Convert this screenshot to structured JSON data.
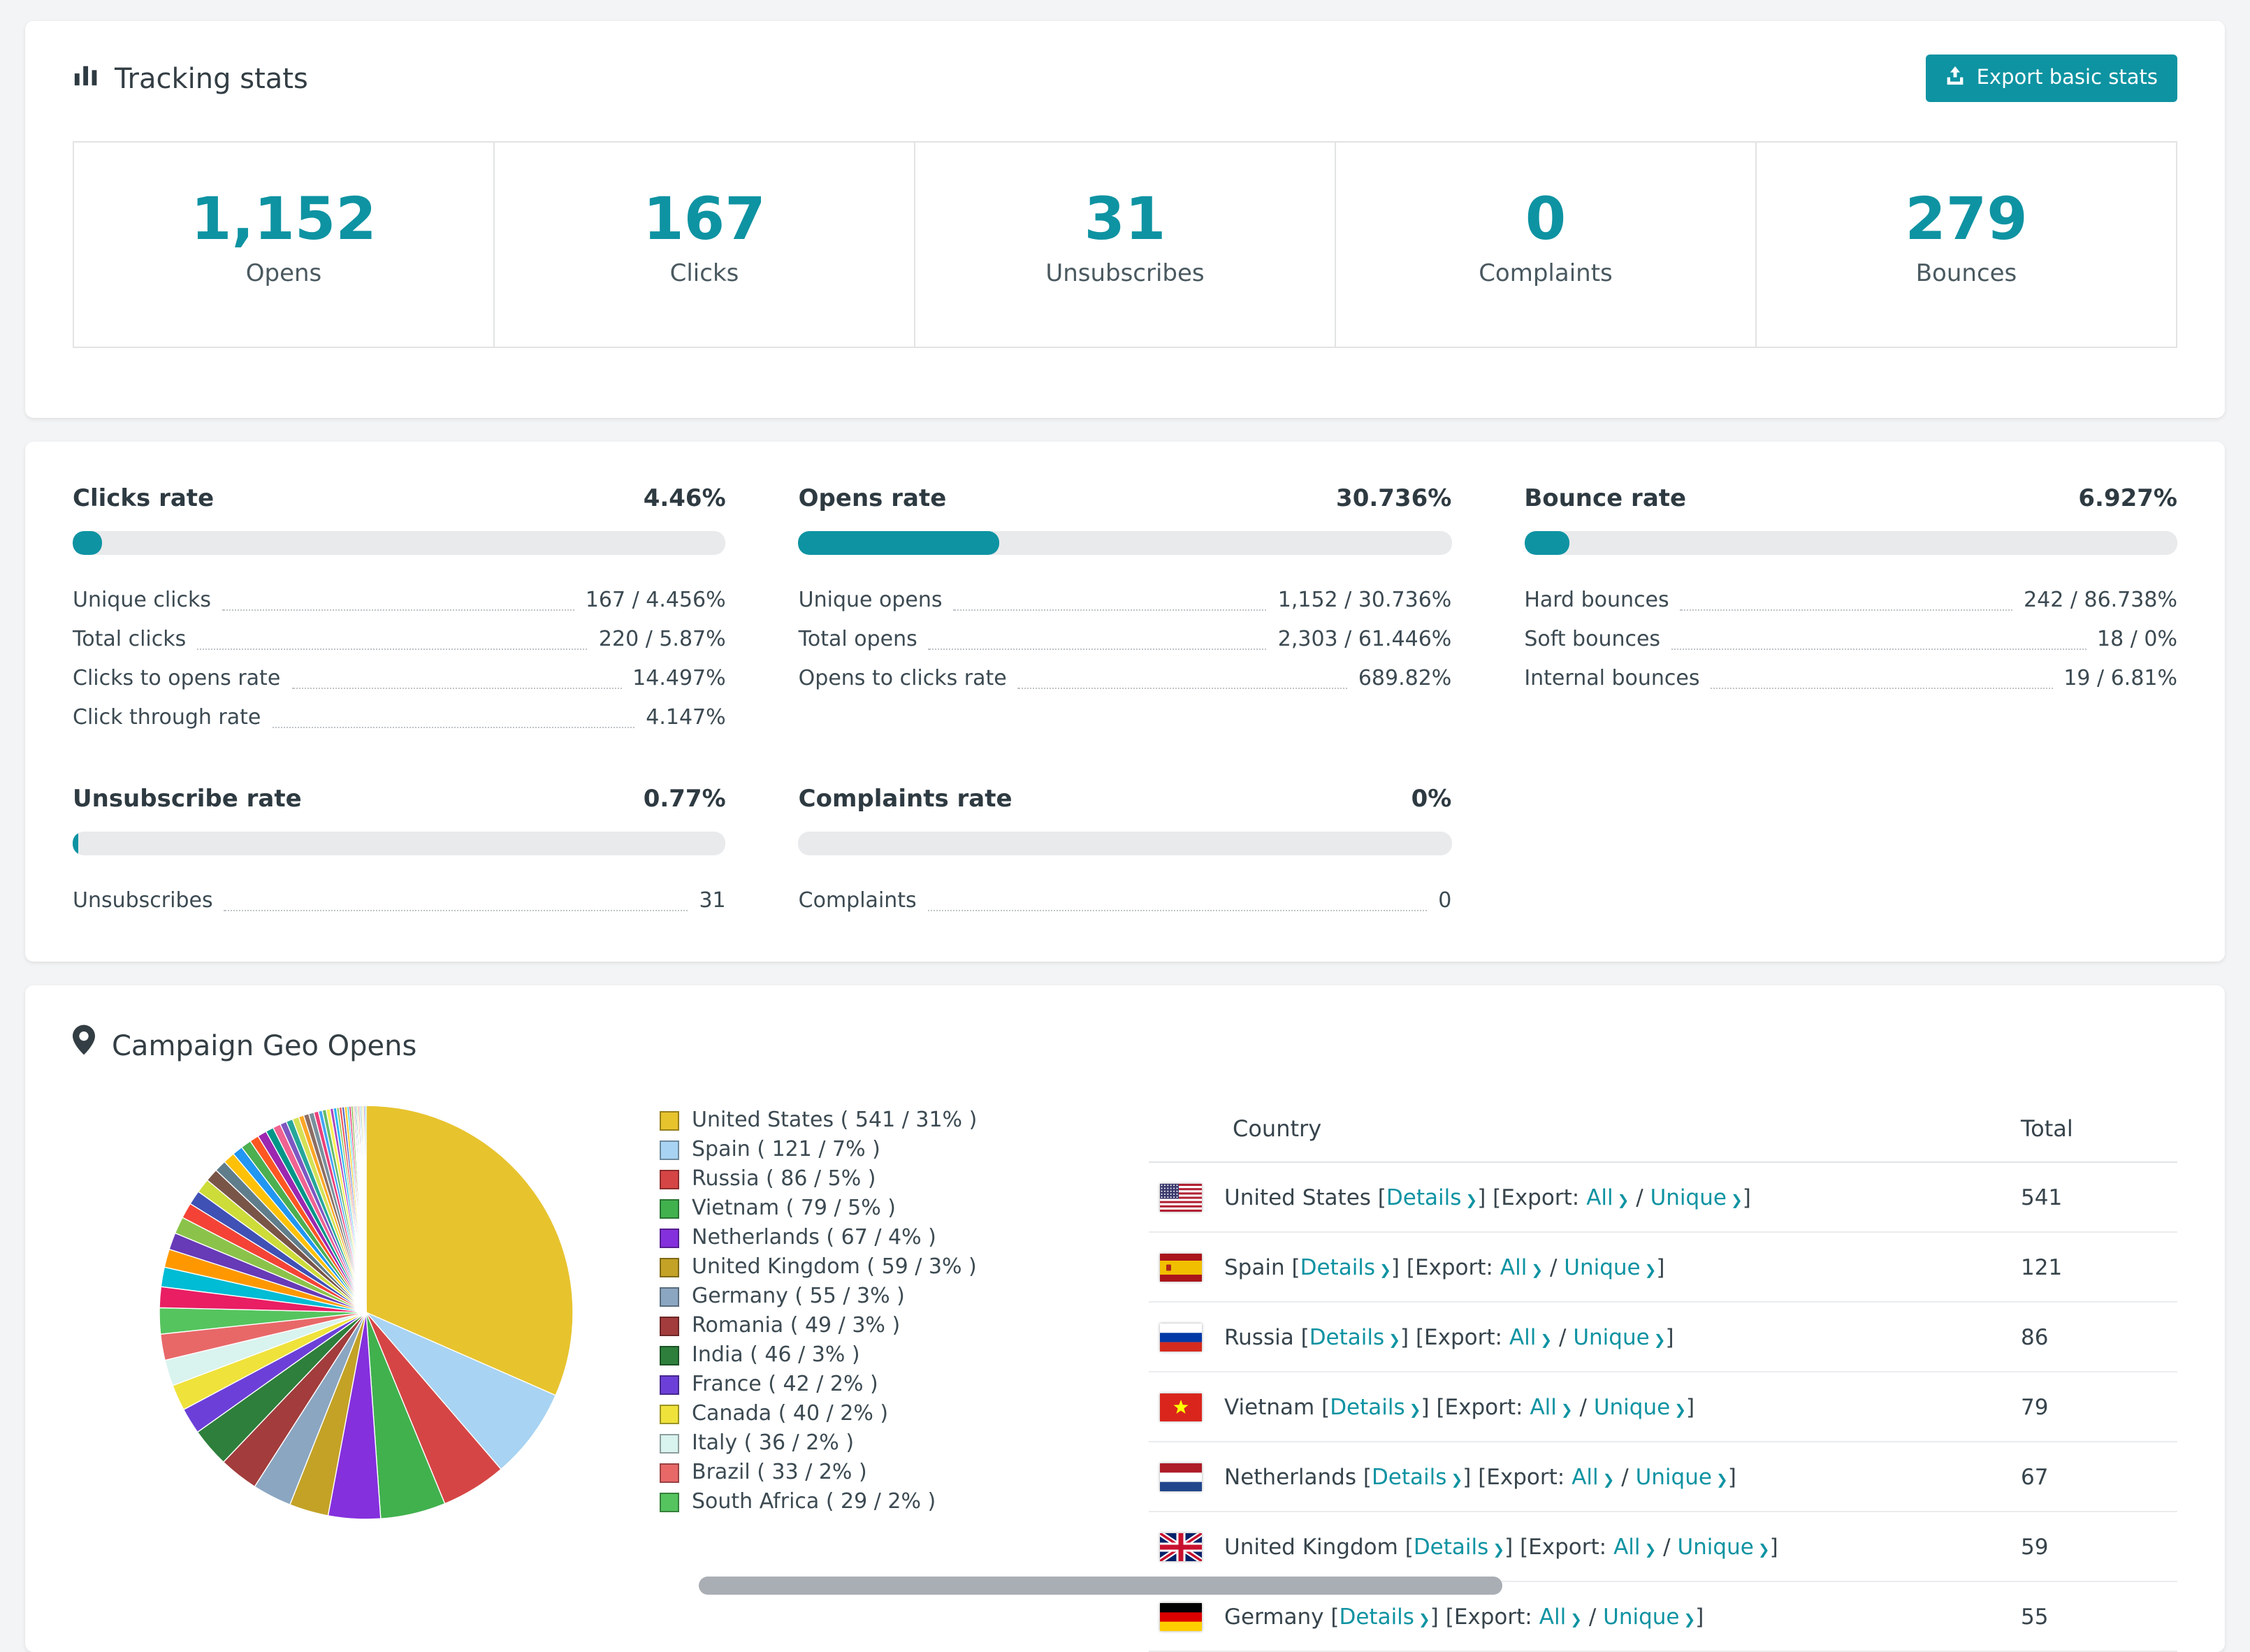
{
  "theme": {
    "accent": "#0e93a2",
    "page_bg": "#f3f4f5"
  },
  "tracking": {
    "title": "Tracking stats",
    "export_button": "Export basic stats",
    "stats": [
      {
        "value": "1,152",
        "label": "Opens"
      },
      {
        "value": "167",
        "label": "Clicks"
      },
      {
        "value": "31",
        "label": "Unsubscribes"
      },
      {
        "value": "0",
        "label": "Complaints"
      },
      {
        "value": "279",
        "label": "Bounces"
      }
    ]
  },
  "rates": [
    {
      "title": "Clicks rate",
      "pct_label": "4.46%",
      "pct": 4.46,
      "rows": [
        {
          "label": "Unique clicks",
          "value": "167 / 4.456%"
        },
        {
          "label": "Total clicks",
          "value": "220 / 5.87%"
        },
        {
          "label": "Clicks to opens rate",
          "value": "14.497%"
        },
        {
          "label": "Click through rate",
          "value": "4.147%"
        }
      ]
    },
    {
      "title": "Opens rate",
      "pct_label": "30.736%",
      "pct": 30.736,
      "rows": [
        {
          "label": "Unique opens",
          "value": "1,152 / 30.736%"
        },
        {
          "label": "Total opens",
          "value": "2,303 / 61.446%"
        },
        {
          "label": "Opens to clicks rate",
          "value": "689.82%"
        }
      ]
    },
    {
      "title": "Bounce rate",
      "pct_label": "6.927%",
      "pct": 6.927,
      "rows": [
        {
          "label": "Hard bounces",
          "value": "242 / 86.738%"
        },
        {
          "label": "Soft bounces",
          "value": "18 / 0%"
        },
        {
          "label": "Internal bounces",
          "value": "19 / 6.81%"
        }
      ]
    },
    {
      "title": "Unsubscribe rate",
      "pct_label": "0.77%",
      "pct": 0.77,
      "rows": [
        {
          "label": "Unsubscribes",
          "value": "31"
        }
      ]
    },
    {
      "title": "Complaints rate",
      "pct_label": "0%",
      "pct": 0,
      "rows": [
        {
          "label": "Complaints",
          "value": "0"
        }
      ]
    }
  ],
  "geo": {
    "title": "Campaign Geo Opens",
    "table_headers": {
      "country": "Country",
      "total": "Total"
    },
    "links": {
      "details": "Details",
      "export": "[Export:",
      "all": "All",
      "unique": "Unique"
    },
    "rows": [
      {
        "name": "United States",
        "flag": "us",
        "total": "541"
      },
      {
        "name": "Spain",
        "flag": "es",
        "total": "121"
      },
      {
        "name": "Russia",
        "flag": "ru",
        "total": "86"
      },
      {
        "name": "Vietnam",
        "flag": "vn",
        "total": "79"
      },
      {
        "name": "Netherlands",
        "flag": "nl",
        "total": "67"
      },
      {
        "name": "United Kingdom",
        "flag": "gb",
        "total": "59"
      },
      {
        "name": "Germany",
        "flag": "de",
        "total": "55"
      }
    ]
  },
  "chart_data": {
    "type": "pie",
    "title": "Campaign Geo Opens",
    "legend_position": "right",
    "series": [
      {
        "label": "United States",
        "value": 541,
        "pct": 31,
        "color": "#e7c32e"
      },
      {
        "label": "Spain",
        "value": 121,
        "pct": 7,
        "color": "#a8d3f2"
      },
      {
        "label": "Russia",
        "value": 86,
        "pct": 5,
        "color": "#d64545"
      },
      {
        "label": "Vietnam",
        "value": 79,
        "pct": 5,
        "color": "#41b14e"
      },
      {
        "label": "Netherlands",
        "value": 67,
        "pct": 4,
        "color": "#8430dd"
      },
      {
        "label": "United Kingdom",
        "value": 59,
        "pct": 3,
        "color": "#c3a226"
      },
      {
        "label": "Germany",
        "value": 55,
        "pct": 3,
        "color": "#8ba6c1"
      },
      {
        "label": "Romania",
        "value": 49,
        "pct": 3,
        "color": "#a33c3c"
      },
      {
        "label": "India",
        "value": 46,
        "pct": 3,
        "color": "#2d7f3b"
      },
      {
        "label": "France",
        "value": 42,
        "pct": 2,
        "color": "#6c40d8"
      },
      {
        "label": "Canada",
        "value": 40,
        "pct": 2,
        "color": "#efe23b"
      },
      {
        "label": "Italy",
        "value": 36,
        "pct": 2,
        "color": "#d9f3ee"
      },
      {
        "label": "Brazil",
        "value": 33,
        "pct": 2,
        "color": "#e86868"
      },
      {
        "label": "South Africa",
        "value": 29,
        "pct": 2,
        "color": "#55c45e"
      }
    ],
    "other_pcts": [
      1.6,
      1.5,
      1.4,
      1.3,
      1.3,
      1.2,
      1.1,
      1.1,
      1.0,
      0.9,
      0.9,
      0.8,
      0.8,
      0.7,
      0.7,
      0.6,
      0.6,
      0.5,
      0.5,
      0.5,
      0.4,
      0.4,
      0.4,
      0.35,
      0.3,
      0.3,
      0.3,
      0.25,
      0.25,
      0.2,
      0.2,
      0.2,
      0.2,
      0.15,
      0.15,
      0.15,
      0.1,
      0.1,
      0.1,
      0.1,
      0.1,
      0.1,
      0.1,
      0.1,
      0.1,
      0.1
    ],
    "other_colors": [
      "#e91e63",
      "#00bcd4",
      "#ff9800",
      "#673ab7",
      "#8bc34a",
      "#f44336",
      "#3f51b5",
      "#cddc39",
      "#795548",
      "#607d8b",
      "#ffc107",
      "#2196f3",
      "#4caf50",
      "#ff5722",
      "#9c27b0",
      "#009688",
      "#f06292",
      "#7e57c2",
      "#26a69a",
      "#d4e157",
      "#ffa726",
      "#8d6e63",
      "#78909c",
      "#ec407a",
      "#42a5f5",
      "#66bb6a",
      "#ffee58",
      "#ab47bc",
      "#29b6f6",
      "#9ccc65",
      "#ef5350",
      "#5c6bc0",
      "#ffca28",
      "#26c6da",
      "#d81b60",
      "#7cb342",
      "#fb8c00",
      "#5e35b1",
      "#00897b",
      "#c0ca33",
      "#e53935",
      "#1e88e5",
      "#43a047",
      "#fdd835",
      "#8e24aa",
      "#00acc1"
    ]
  }
}
